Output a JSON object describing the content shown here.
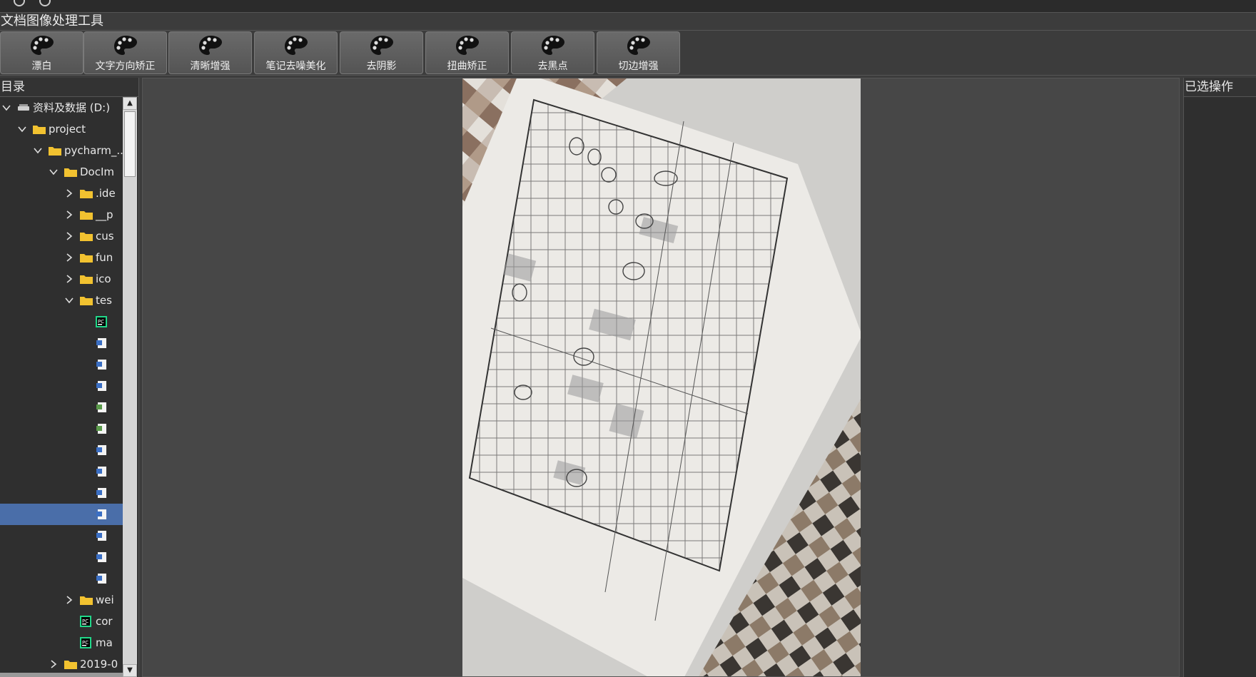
{
  "app": {
    "title": "文档图像处理工具"
  },
  "toolbar": {
    "buttons": [
      {
        "label": "漂白",
        "icon": "palette-icon"
      },
      {
        "label": "文字方向矫正",
        "icon": "palette-icon"
      },
      {
        "label": "清晰增强",
        "icon": "palette-icon"
      },
      {
        "label": "笔记去噪美化",
        "icon": "palette-icon"
      },
      {
        "label": "去阴影",
        "icon": "palette-icon"
      },
      {
        "label": "扭曲矫正",
        "icon": "palette-icon"
      },
      {
        "label": "去黑点",
        "icon": "palette-icon"
      },
      {
        "label": "切边增强",
        "icon": "palette-icon"
      }
    ]
  },
  "left_panel": {
    "title": "目录",
    "tree": [
      {
        "label": "资料及数据 (D:)",
        "level": 0,
        "type": "drive",
        "expanded": true
      },
      {
        "label": "project",
        "level": 1,
        "type": "folder",
        "expanded": true
      },
      {
        "label": "pycharm_...",
        "level": 2,
        "type": "folder",
        "expanded": true
      },
      {
        "label": "DocIm",
        "level": 3,
        "type": "folder",
        "expanded": true
      },
      {
        "label": ".ide",
        "level": 4,
        "type": "folder",
        "expanded": false
      },
      {
        "label": "__p",
        "level": 4,
        "type": "folder",
        "expanded": false
      },
      {
        "label": "cus",
        "level": 4,
        "type": "folder",
        "expanded": false
      },
      {
        "label": "fun",
        "level": 4,
        "type": "folder",
        "expanded": false
      },
      {
        "label": "ico",
        "level": 4,
        "type": "folder",
        "expanded": false
      },
      {
        "label": "tes",
        "level": 4,
        "type": "folder",
        "expanded": true
      },
      {
        "label": "",
        "level": 5,
        "type": "pycharm-file"
      },
      {
        "label": "",
        "level": 5,
        "type": "image-file"
      },
      {
        "label": "",
        "level": 5,
        "type": "image-file"
      },
      {
        "label": "",
        "level": 5,
        "type": "image-file"
      },
      {
        "label": "",
        "level": 5,
        "type": "green-file"
      },
      {
        "label": "",
        "level": 5,
        "type": "green-file"
      },
      {
        "label": "",
        "level": 5,
        "type": "image-file"
      },
      {
        "label": "",
        "level": 5,
        "type": "image-file"
      },
      {
        "label": "",
        "level": 5,
        "type": "image-file"
      },
      {
        "label": "",
        "level": 5,
        "type": "image-file",
        "selected": true
      },
      {
        "label": "",
        "level": 5,
        "type": "image-file"
      },
      {
        "label": "",
        "level": 5,
        "type": "image-file"
      },
      {
        "label": "",
        "level": 5,
        "type": "image-file"
      },
      {
        "label": "wei",
        "level": 4,
        "type": "folder",
        "expanded": false
      },
      {
        "label": "cor",
        "level": 4,
        "type": "pycharm-file"
      },
      {
        "label": "ma",
        "level": 4,
        "type": "pycharm-file"
      },
      {
        "label": "2019-0",
        "level": 3,
        "type": "folder",
        "expanded": false
      }
    ]
  },
  "viewer": {
    "image": "photo of a handwritten grid worksheet lying on a checkered tablecloth"
  },
  "right_panel": {
    "title": "已选操作"
  },
  "colors": {
    "background": "#3c3c3c",
    "panel": "#2f2f2f",
    "selection": "#4a6ea9",
    "folder": "#f2c230"
  }
}
